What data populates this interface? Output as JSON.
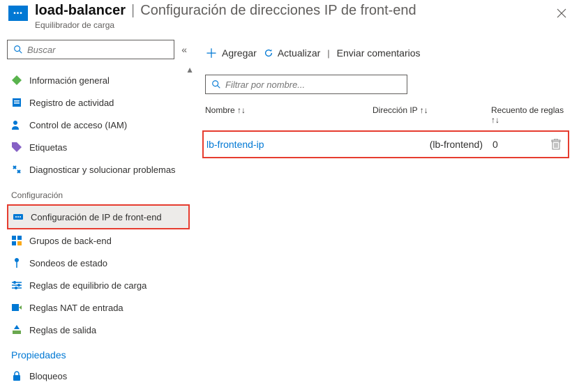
{
  "header": {
    "title": "load-balancer",
    "sep": "|",
    "subtitle": "Configuración de direcciones IP de front-end",
    "caption": "Equilibrador de carga"
  },
  "sidebar": {
    "search_placeholder": "Buscar",
    "collapse": "«",
    "items": [
      {
        "label": "Información general"
      },
      {
        "label": "Registro de actividad"
      },
      {
        "label": "Control de acceso (IAM)"
      },
      {
        "label": "Etiquetas"
      },
      {
        "label": "Diagnosticar y solucionar problemas"
      }
    ],
    "section_config": "Configuración",
    "config_items": [
      {
        "label": "Configuración de IP de front-end"
      },
      {
        "label": "Grupos de back-end"
      },
      {
        "label": "Sondeos de estado"
      },
      {
        "label": "Reglas de equilibrio de carga"
      },
      {
        "label": "Reglas NAT de entrada"
      },
      {
        "label": "Reglas de salida"
      }
    ],
    "props": "Propiedades",
    "locks": "Bloqueos"
  },
  "main": {
    "toolbar": {
      "add": "Agregar",
      "refresh": "Actualizar",
      "feedback": "Enviar comentarios"
    },
    "filter_placeholder": "Filtrar por nombre...",
    "columns": {
      "name": "Nombre ↑↓",
      "ip": "Dirección IP ↑↓",
      "rules": "Recuento de reglas ↑↓"
    },
    "rows": [
      {
        "name": "lb-frontend-ip",
        "ip": "(lb-frontend)",
        "rules": "0"
      }
    ]
  }
}
